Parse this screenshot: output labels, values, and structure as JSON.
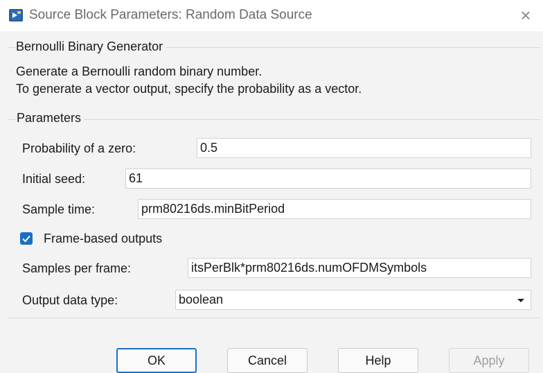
{
  "window": {
    "title": "Source Block Parameters: Random Data Source",
    "close_symbol": "×"
  },
  "block": {
    "name": "Bernoulli Binary Generator",
    "description": [
      "Generate a Bernoulli random binary number.",
      "To generate a vector output, specify the probability as a vector."
    ]
  },
  "parameters": {
    "heading": "Parameters",
    "probability_label": "Probability of a zero:",
    "probability_value": "0.5",
    "seed_label": "Initial seed:",
    "seed_value": "61",
    "sample_time_label": "Sample time:",
    "sample_time_value": "prm80216ds.minBitPeriod",
    "frame_based_label": "Frame-based outputs",
    "frame_based_checked": true,
    "samples_per_frame_label": "Samples per frame:",
    "samples_per_frame_value": "itsPerBlk*prm80216ds.numOFDMSymbols",
    "output_type_label": "Output data type:",
    "output_type_value": "boolean"
  },
  "buttons": {
    "ok": "OK",
    "cancel": "Cancel",
    "help": "Help",
    "apply": "Apply"
  },
  "colors": {
    "accent": "#1a6fc4",
    "background": "#f3f3f3"
  }
}
